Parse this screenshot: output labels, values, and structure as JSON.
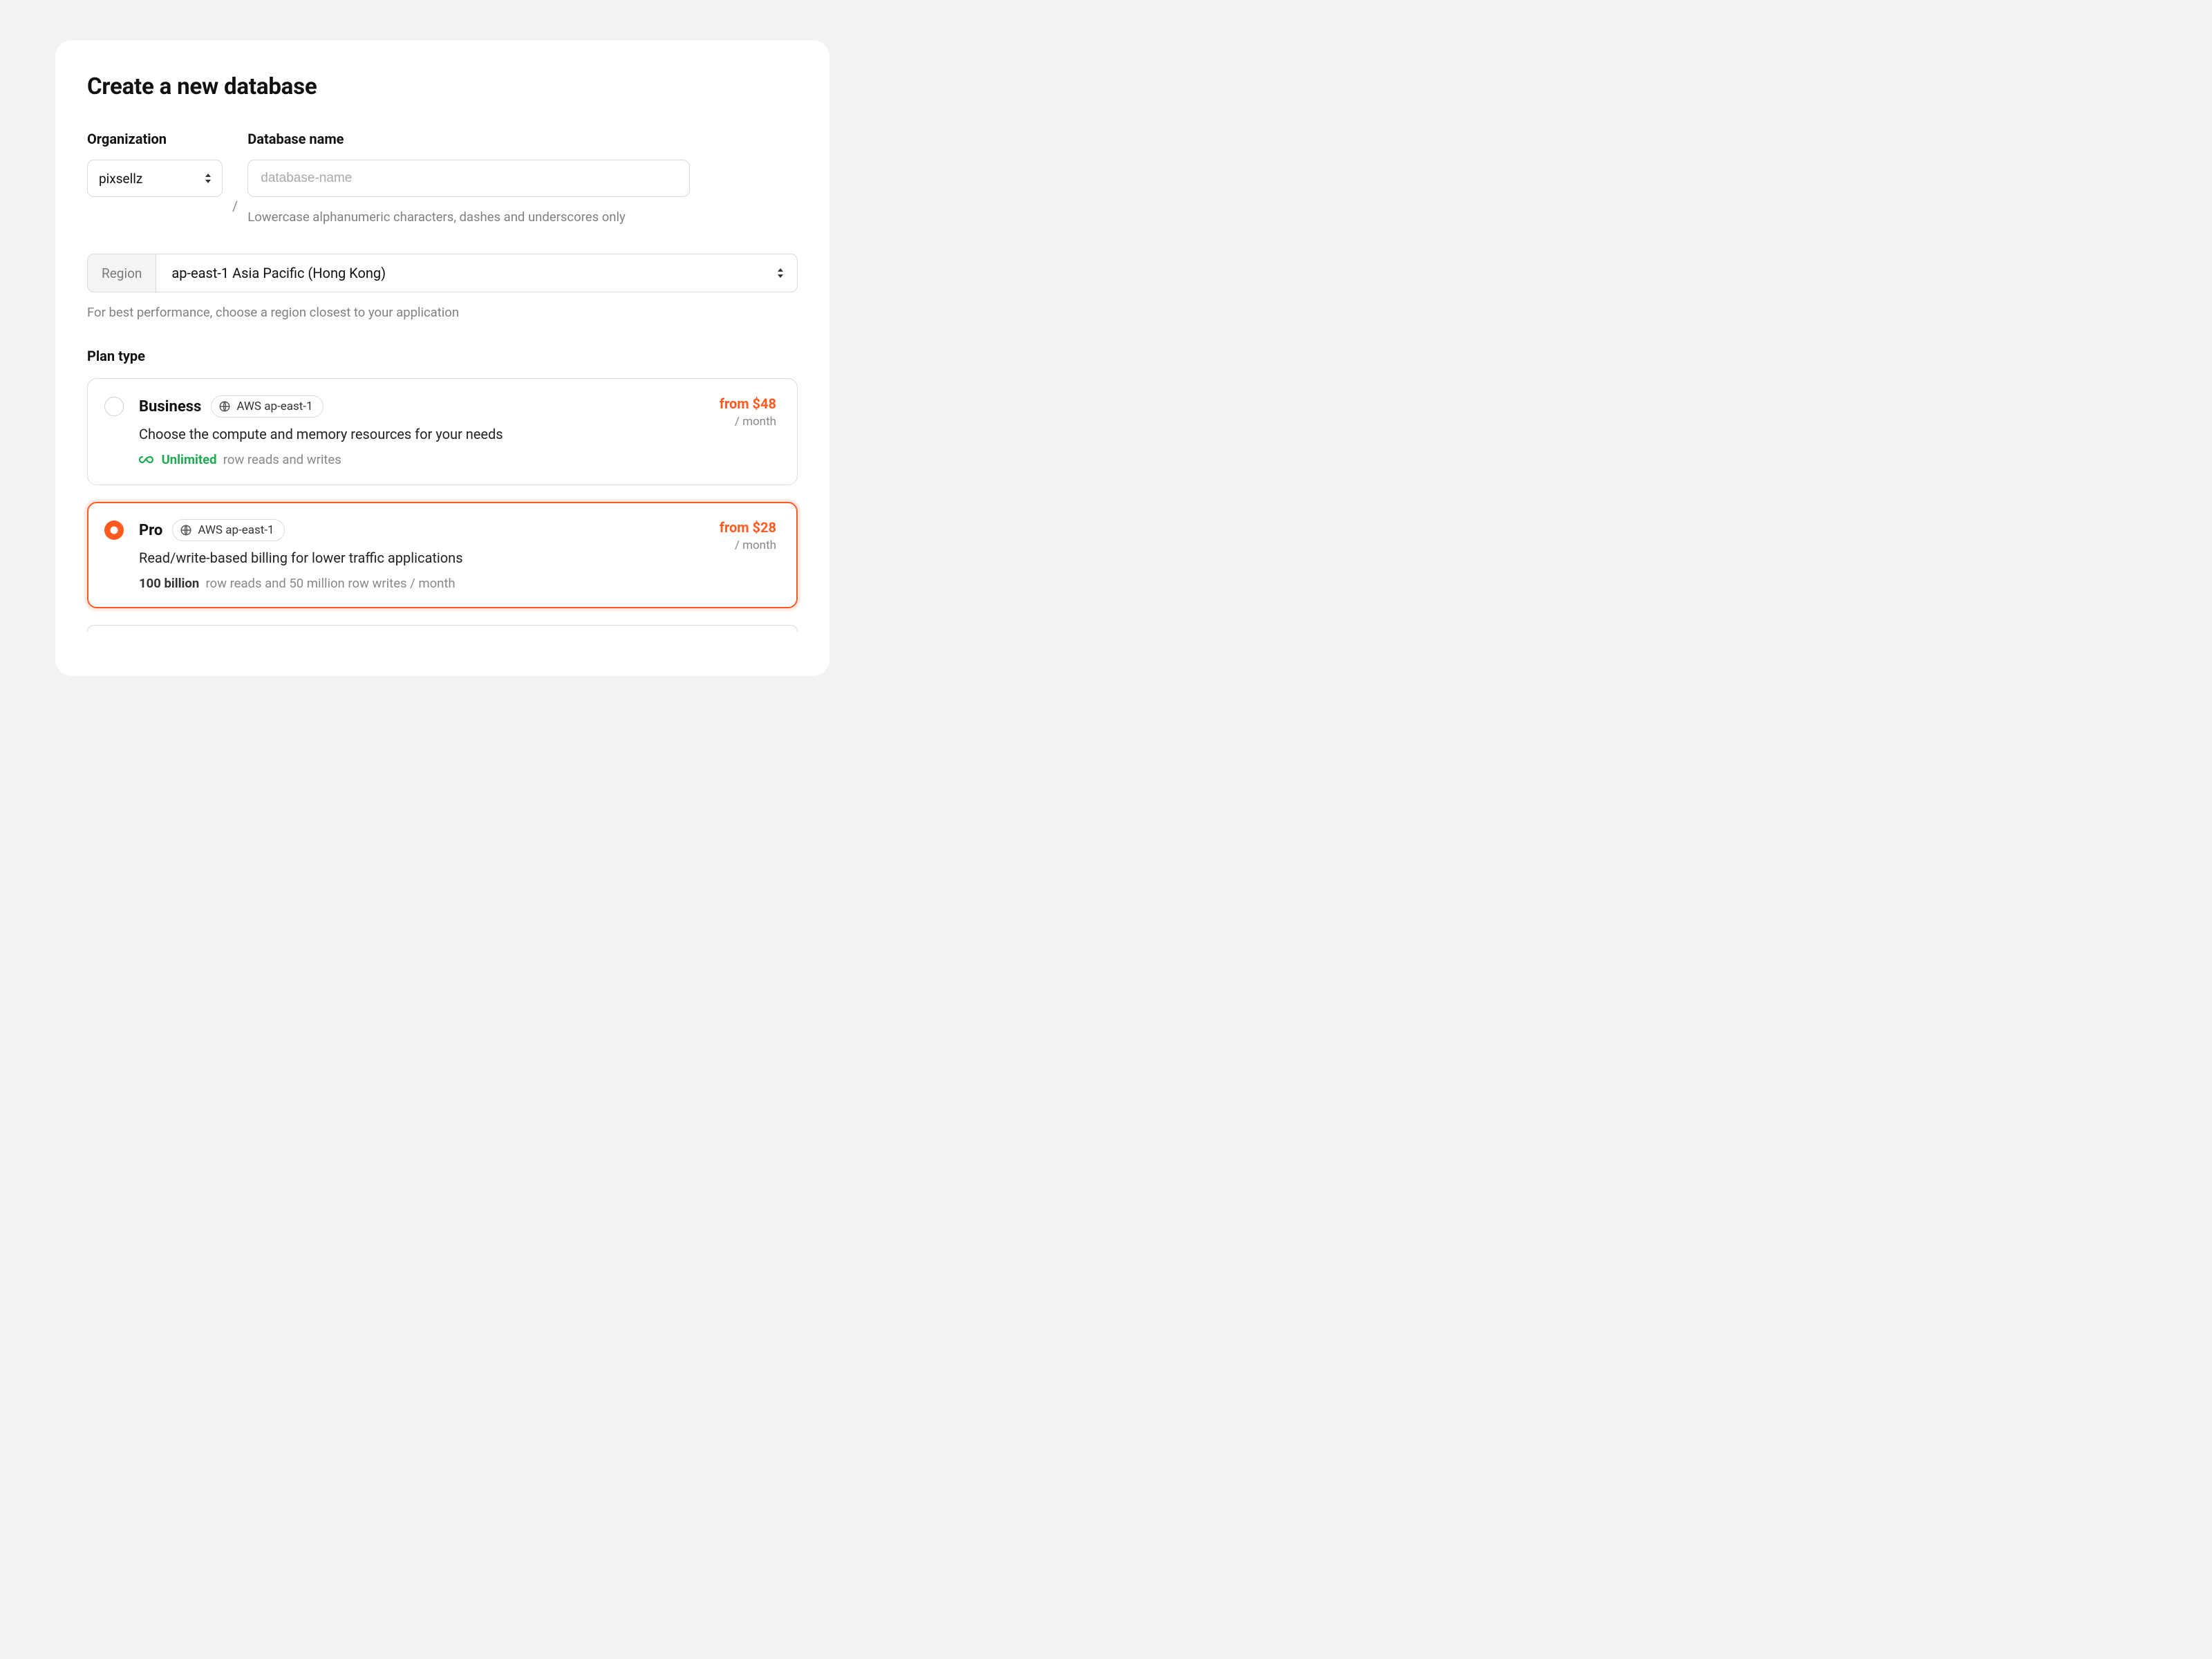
{
  "title": "Create a new database",
  "organization": {
    "label": "Organization",
    "value": "pixsellz"
  },
  "slash": "/",
  "database": {
    "label": "Database name",
    "placeholder": "database-name",
    "hint": "Lowercase alphanumeric characters, dashes and underscores only"
  },
  "region": {
    "prefix": "Region",
    "value": "ap-east-1 Asia Pacific (Hong Kong)",
    "hint": "For best performance, choose a region closest to your application"
  },
  "plan": {
    "label": "Plan type",
    "options": [
      {
        "name": "Business",
        "badge": "AWS ap-east-1",
        "description": "Choose the compute and memory resources for your needs",
        "meta_bold": "Unlimited",
        "meta_rest": "row reads and writes",
        "price": "from $48",
        "period": "/ month",
        "selected": false,
        "unlimited_icon": true
      },
      {
        "name": "Pro",
        "badge": "AWS ap-east-1",
        "description": "Read/write-based billing for lower traffic applications",
        "meta_bold": "100 billion",
        "meta_rest": "row reads and 50 million row writes / month",
        "price": "from $28",
        "period": "/ month",
        "selected": true,
        "unlimited_icon": false
      }
    ]
  }
}
